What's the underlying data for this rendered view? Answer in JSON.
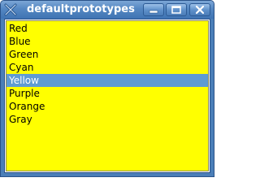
{
  "window": {
    "title": "defaultprototypes"
  },
  "titlebar_buttons": {
    "minimize_icon": "minimize-icon",
    "maximize_icon": "maximize-icon",
    "close_icon": "close-icon"
  },
  "list": {
    "background": "#ffff00",
    "selection_color": "#5f9bd3",
    "selected_index": 4,
    "items": [
      "Red",
      "Blue",
      "Green",
      "Cyan",
      "Yellow",
      "Purple",
      "Orange",
      "Gray"
    ]
  }
}
